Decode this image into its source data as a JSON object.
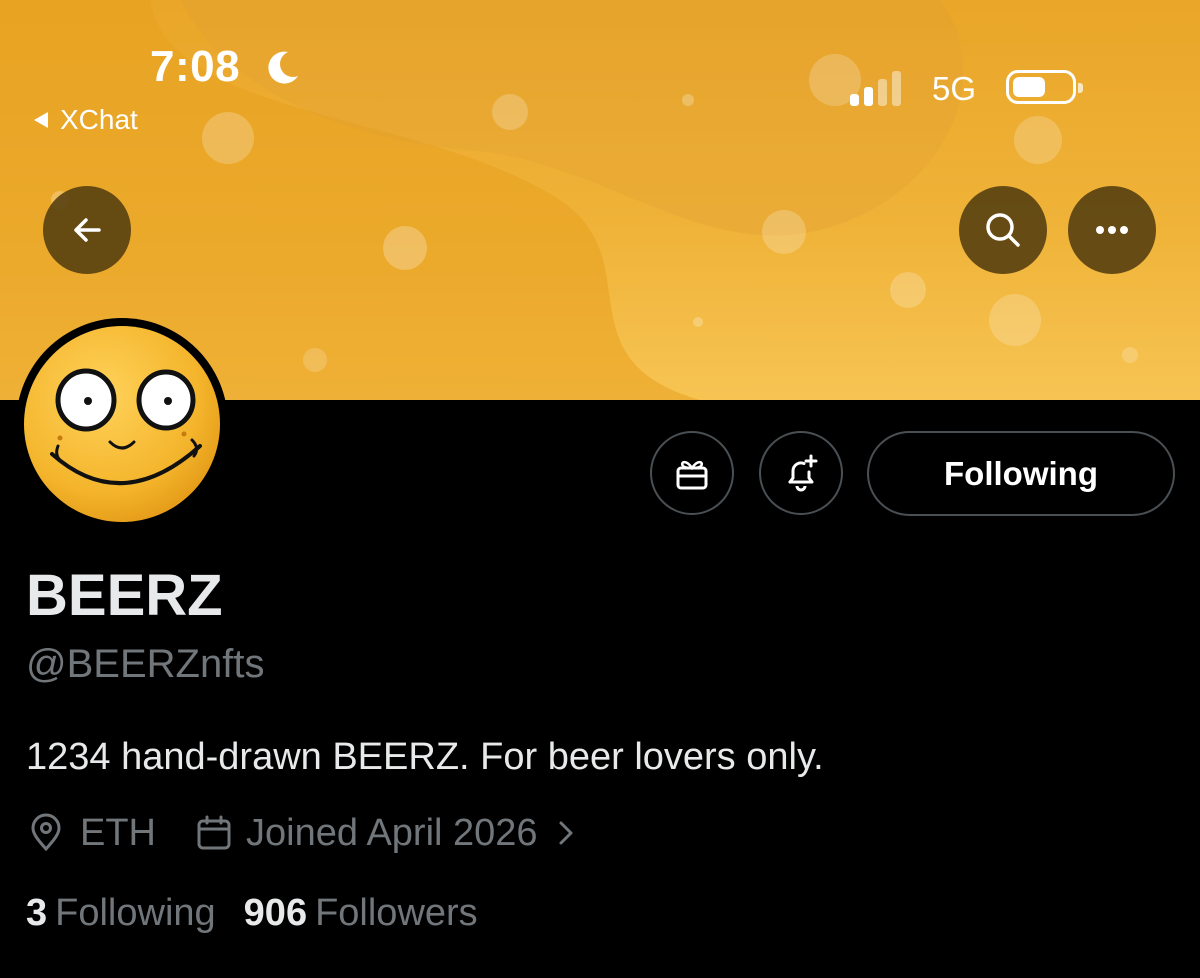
{
  "status_bar": {
    "time": "7:08",
    "back_app": "XChat",
    "network": "5G"
  },
  "icons": {
    "moon": "moon-icon",
    "back": "arrow-left-icon",
    "search": "search-icon",
    "more": "more-dots-icon",
    "gift": "gift-icon",
    "notify": "bell-plus-icon",
    "location": "location-pin-icon",
    "calendar": "calendar-icon",
    "chevron": "chevron-right-icon"
  },
  "colors": {
    "banner": "#f0b43a",
    "background": "#000000",
    "muted_text": "#71767b",
    "primary_text": "#e7e9ea"
  },
  "profile": {
    "display_name": "BEERZ",
    "handle": "@BEERZnfts",
    "bio": "1234 hand-drawn BEERZ. For beer lovers only.",
    "location": "ETH",
    "joined": "Joined April 2026"
  },
  "actions": {
    "follow_label": "Following"
  },
  "stats": {
    "following_count": "3",
    "following_label": "Following",
    "followers_count": "906",
    "followers_label": "Followers"
  }
}
